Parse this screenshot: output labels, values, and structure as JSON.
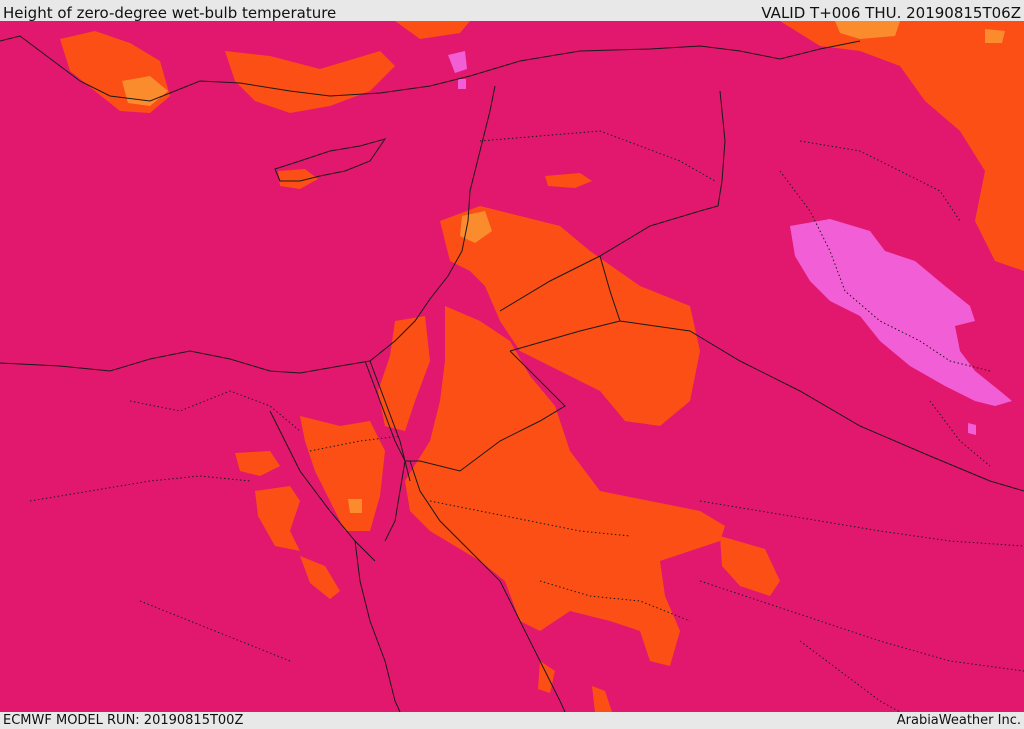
{
  "header": {
    "title": "Height of zero-degree wet-bulb temperature",
    "valid": "VALID T+006 THU. 20190815T06Z"
  },
  "footer": {
    "model_run": "ECMWF MODEL RUN: 20190815T00Z",
    "credit": "ArabiaWeather Inc."
  },
  "colors": {
    "base_level": "#e2186e",
    "orange_level": "#fb4f15",
    "light_orange_level": "#fb8c2e",
    "pink_level": "#f25ed6",
    "boundaries": "#1a1a1a",
    "bars": "#e8e8e8"
  }
}
